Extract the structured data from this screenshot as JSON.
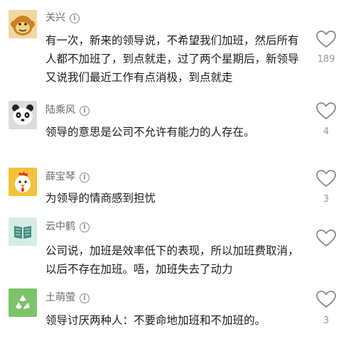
{
  "comments": [
    {
      "username": "关兴",
      "text": "有一次，新来的领导说，不希望我们加班，然后所有人都不加班了，到点就走，过了两个星期后，新领导又说我们最近工作有点消极，到点就走",
      "like_count": "189",
      "avatar_icon": "monkey-avatar-icon"
    },
    {
      "username": "陆乘风",
      "text": "领导的意思是公司不允许有能力的人存在。",
      "like_count": "4",
      "avatar_icon": "panda-avatar-icon"
    },
    {
      "username": "薛宝琴",
      "text": "为领导的情商感到担忧",
      "like_count": "3",
      "avatar_icon": "rooster-avatar-icon"
    },
    {
      "username": "云中鹤",
      "text": "公司说，加班是效率低下的表现，所以加班费取消，以后不存在加班。唔，加班失去了动力",
      "like_count": "",
      "avatar_icon": "book-avatar-icon"
    },
    {
      "username": "土萌萤",
      "text": "领导讨厌两种人：不要命地加班和不加班的。",
      "like_count": "3",
      "avatar_icon": "recycle-avatar-icon"
    }
  ],
  "icons": {
    "info": "i",
    "like": "heart-outline-icon"
  },
  "colors": {
    "text": "#1c1c1c",
    "username": "#6b6b6b",
    "count": "#9a9a9a",
    "icon": "#8a8a8a"
  }
}
